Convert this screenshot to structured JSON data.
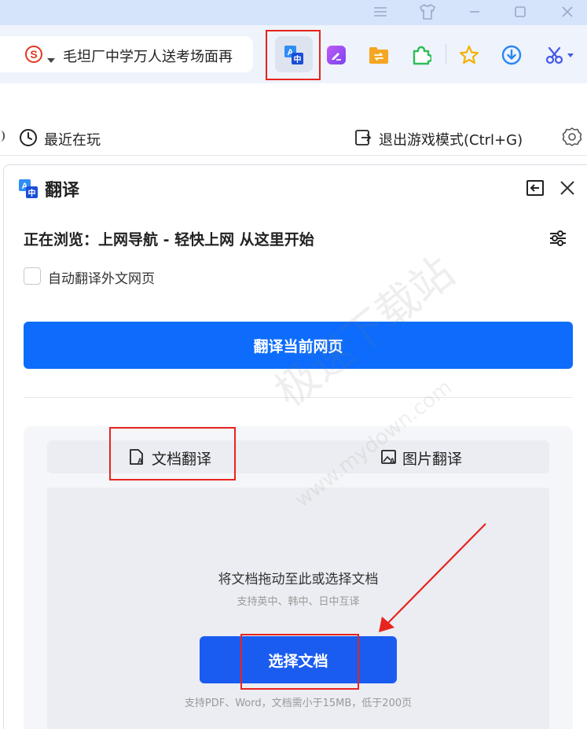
{
  "toolbar": {
    "address_text": "毛坦厂中学万人送考场面再"
  },
  "bookmarks": {
    "recent_label": "最近在玩",
    "exit_game_label": "退出游戏模式(Ctrl+G)"
  },
  "panel": {
    "title": "翻译",
    "browsing_text": "正在浏览：上网导航 - 轻快上网 从这里开始",
    "auto_translate_label": "自动翻译外文网页",
    "translate_page_button": "翻译当前网页",
    "tabs": [
      {
        "label": "文档翻译",
        "active": true
      },
      {
        "label": "图片翻译",
        "active": false
      }
    ],
    "drop_title": "将文档拖动至此或选择文档",
    "drop_subtitle": "支持英中、韩中、日中互译",
    "select_button": "选择文档",
    "footer_note": "支持PDF、Word，文档需小于15MB，低于200页"
  },
  "watermark": {
    "main": "极速下载站",
    "url": "www.mydown.com"
  },
  "colors": {
    "primary_button": "#0d6cfc",
    "select_button": "#1a5cf0",
    "annotation_red": "#e8231e"
  }
}
